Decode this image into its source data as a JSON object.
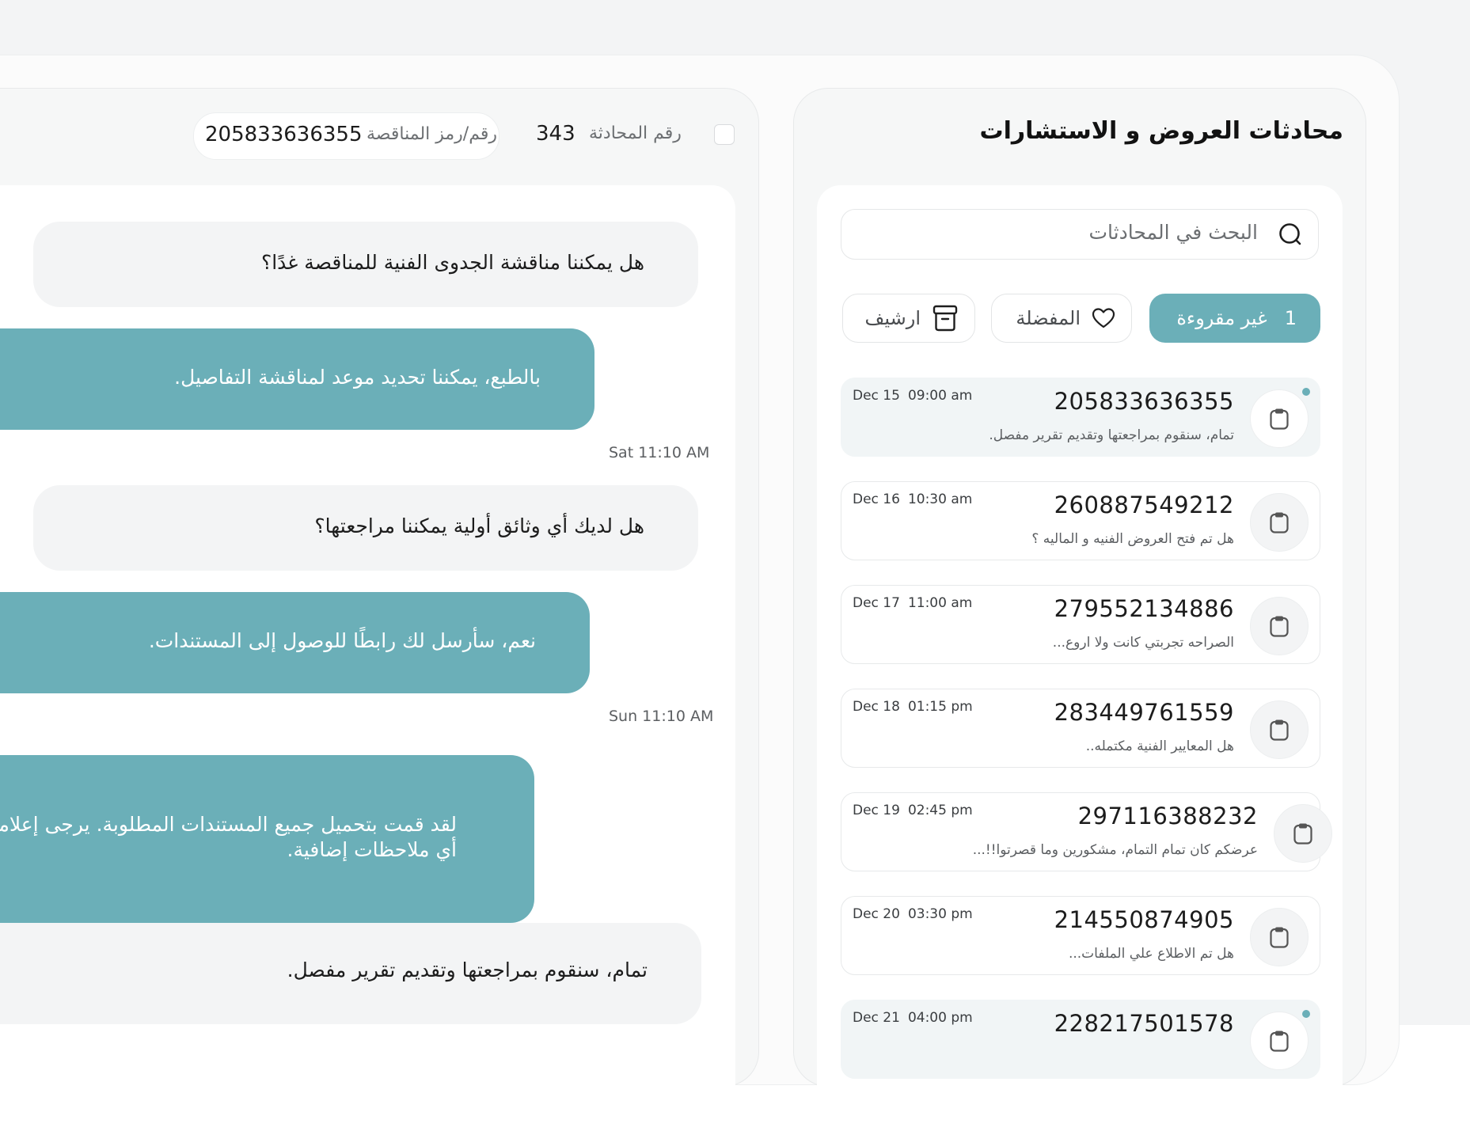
{
  "inbox": {
    "title": "محادثات العروض و الاستشارات",
    "search_placeholder": "البحث في المحادثات",
    "filters": {
      "unread_count": "1",
      "unread_label": "غير مقروءة",
      "favorites_label": "المفضلة",
      "archive_label": "ارشيف"
    },
    "conversations": [
      {
        "number": "205833636355",
        "preview": "تمام، سنقوم بمراجعتها وتقديم تقرير مفصل.",
        "date": "Dec 15",
        "time": "09:00 am",
        "unread": true
      },
      {
        "number": "260887549212",
        "preview": "هل تم فتح العروض الفنيه و الماليه ؟",
        "date": "Dec 16",
        "time": "10:30 am",
        "unread": false
      },
      {
        "number": "279552134886",
        "preview": "الصراحه تجربتي كانت ولا اروع...",
        "date": "Dec 17",
        "time": "11:00 am",
        "unread": false
      },
      {
        "number": "283449761559",
        "preview": "هل المعايير الفنية مكتمله..",
        "date": "Dec 18",
        "time": "01:15 pm",
        "unread": false
      },
      {
        "number": "297116388232",
        "preview": "عرضكم كان تمام التمام، مشكورين وما قصرتوا!!...",
        "date": "Dec 19",
        "time": "02:45 pm",
        "unread": false
      },
      {
        "number": "214550874905",
        "preview": "هل تم الاطلاع علي الملفات...",
        "date": "Dec 20",
        "time": "03:30 pm",
        "unread": false
      },
      {
        "number": "228217501578",
        "preview": "",
        "date": "Dec 21",
        "time": "04:00 pm",
        "unread": true
      }
    ]
  },
  "chat": {
    "conversation_label": "رقم المحادثة",
    "conversation_id": "343",
    "tender_label": "رقم/رمز المناقصة",
    "tender_id": "205833636355",
    "messages": [
      {
        "direction": "incoming",
        "text": "هل يمكننا مناقشة الجدوى الفنية للمناقصة غدًا؟"
      },
      {
        "direction": "outgoing",
        "text": "بالطبع، يمكننا تحديد موعد لمناقشة التفاصيل.",
        "time": "Sat 11:10 AM"
      },
      {
        "direction": "incoming",
        "text": "هل لديك أي وثائق أولية يمكننا مراجعتها؟"
      },
      {
        "direction": "outgoing",
        "text": "نعم، سأرسل لك رابطًا للوصول إلى المستندات.",
        "time": "Sun 11:10 AM"
      },
      {
        "direction": "outgoing",
        "text": "لقد قمت بتحميل جميع المستندات المطلوبة. يرجى إعلامي إذا كانت هناك أي ملاحظات إضافية."
      },
      {
        "direction": "incoming",
        "text": "تمام، سنقوم بمراجعتها وتقديم تقرير مفصل."
      }
    ]
  },
  "colors": {
    "accent": "#6bafb8",
    "panel_bg": "#f6f7f7",
    "bubble_incoming": "#f3f4f5"
  },
  "icons": {
    "search": "search-icon",
    "heart": "heart-icon",
    "archive": "archive-box-icon",
    "avatar": "clipboard-icon"
  }
}
